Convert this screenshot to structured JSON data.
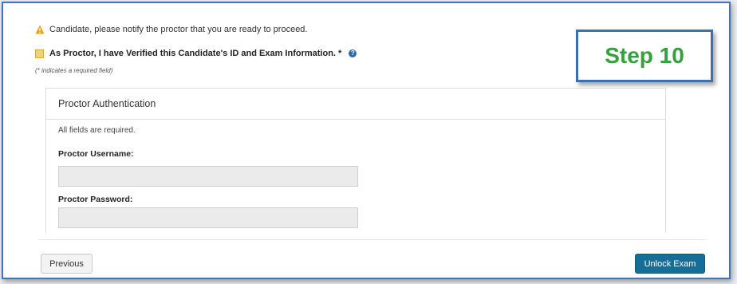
{
  "notice": {
    "icon": "warning-icon",
    "text": "Candidate, please notify the proctor that you are ready to proceed."
  },
  "verify": {
    "label": "As Proctor, I have Verified this Candidate's ID and Exam Information. *",
    "checked": false,
    "help_icon": "help-icon"
  },
  "required_note": "(* indicates a required field)",
  "step_badge": "Step 10",
  "panel": {
    "title": "Proctor Authentication",
    "all_required": "All fields are required.",
    "username_label": "Proctor Username:",
    "username_value": "",
    "password_label": "Proctor Password:",
    "password_value": ""
  },
  "buttons": {
    "previous": "Previous",
    "unlock": "Unlock Exam"
  },
  "colors": {
    "accent": "#166d96",
    "badge_text": "#33a23b",
    "badge_border": "#3e6fb0",
    "warning": "#e8a317"
  }
}
